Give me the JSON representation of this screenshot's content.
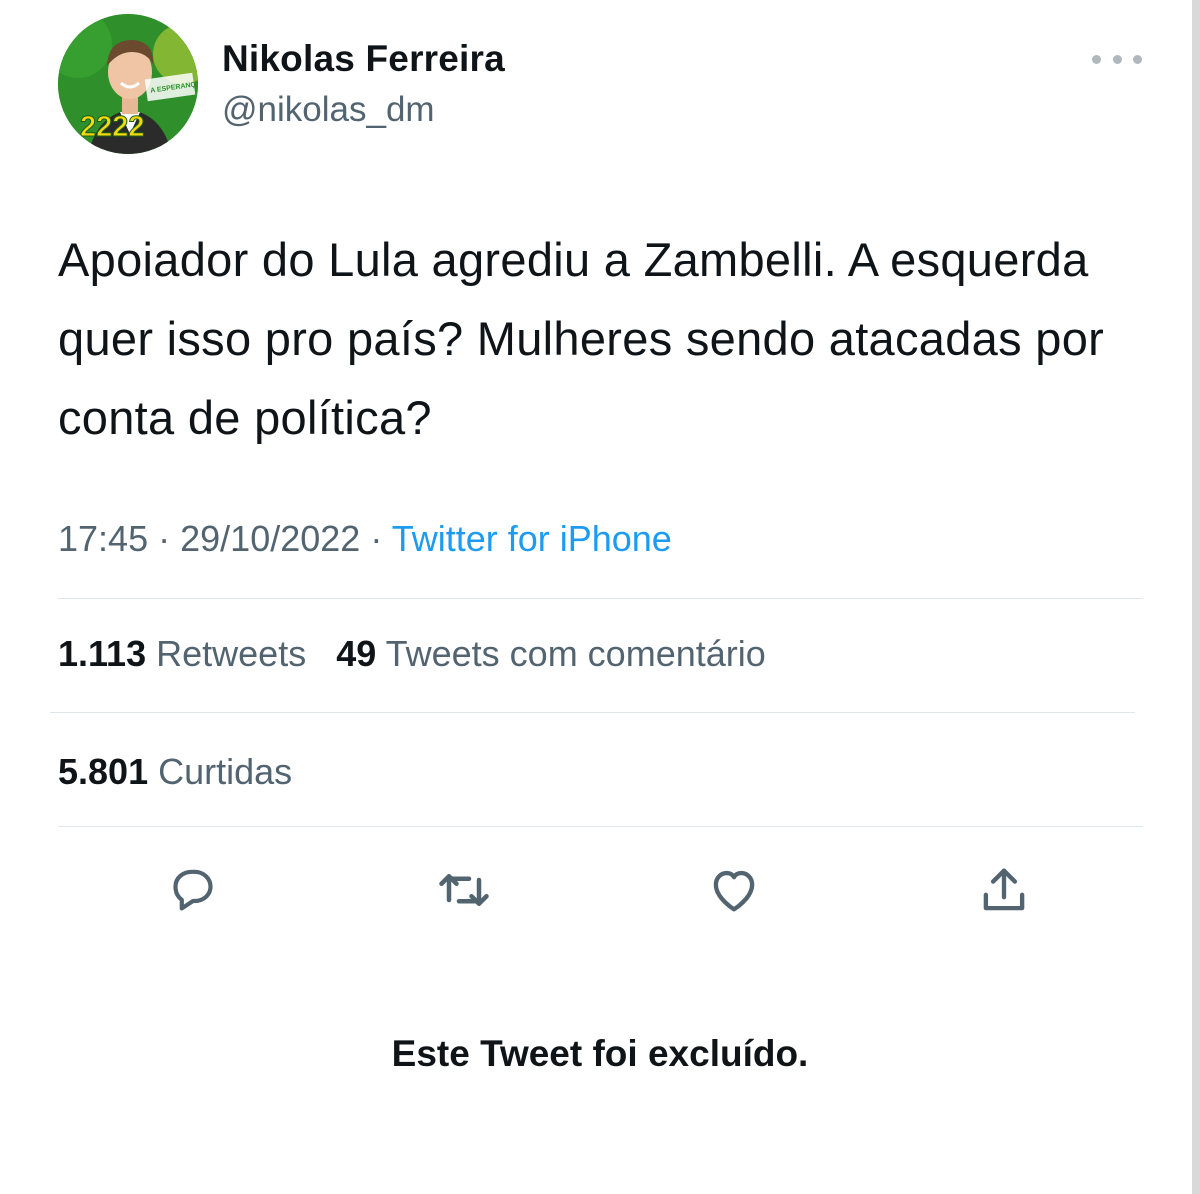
{
  "tweet": {
    "author": {
      "display_name": "Nikolas Ferreira",
      "handle": "@nikolas_dm",
      "avatar_badge": "2222",
      "avatar_banner": "A ESPERANÇA SOMOS NÓS"
    },
    "text": "Apoiador do Lula agrediu a Zambelli. A esquerda quer isso pro país? Mulheres sendo atacadas por conta de política?",
    "time": "17:45",
    "date": "29/10/2022",
    "separator": "·",
    "source": "Twitter for iPhone"
  },
  "stats": {
    "retweets_count": "1.113",
    "retweets_label": "Retweets",
    "quotes_count": "49",
    "quotes_label": "Tweets com comentário",
    "likes_count": "5.801",
    "likes_label": "Curtidas"
  },
  "actions": [
    {
      "name": "reply",
      "icon": "reply-icon"
    },
    {
      "name": "retweet",
      "icon": "retweet-icon"
    },
    {
      "name": "like",
      "icon": "heart-icon"
    },
    {
      "name": "share",
      "icon": "share-icon"
    }
  ],
  "notice": {
    "deleted_text": "Este Tweet foi excluído."
  },
  "colors": {
    "text_primary": "#0f1419",
    "text_secondary": "#536471",
    "link": "#1d9bf0",
    "divider": "#e1e6ea",
    "avatar_green": "#2f8f2a",
    "avatar_yellow": "#f5d90a"
  }
}
